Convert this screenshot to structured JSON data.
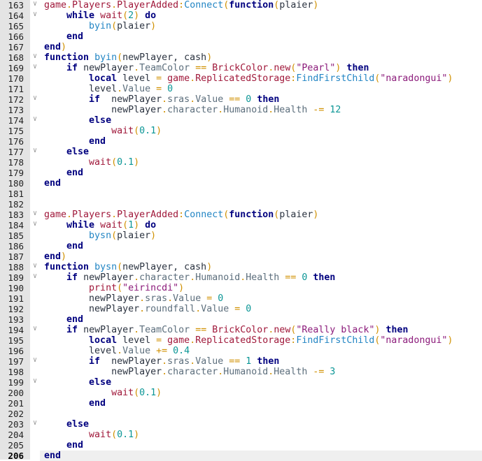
{
  "editor": {
    "current_line": 206,
    "fold_lines": [
      163,
      164,
      168,
      169,
      172,
      174,
      177,
      183,
      184,
      188,
      189,
      194,
      197,
      199,
      203
    ],
    "lines": [
      {
        "n": 163,
        "t": [
          [
            "g",
            "game"
          ],
          [
            "o",
            "."
          ],
          [
            "g",
            "Players"
          ],
          [
            "o",
            "."
          ],
          [
            "g",
            "PlayerAdded"
          ],
          [
            "o",
            ":"
          ],
          [
            "b",
            "Connect"
          ],
          [
            "o",
            "("
          ],
          [
            "k",
            "function"
          ],
          [
            "o",
            "("
          ],
          [
            "i",
            "plaier"
          ],
          [
            "o",
            ")"
          ]
        ]
      },
      {
        "n": 164,
        "t": [
          [
            "w",
            "    "
          ],
          [
            "k",
            "while"
          ],
          [
            "w",
            " "
          ],
          [
            "g",
            "wait"
          ],
          [
            "o",
            "("
          ],
          [
            "n",
            "2"
          ],
          [
            "o",
            ")"
          ],
          [
            "w",
            " "
          ],
          [
            "k",
            "do"
          ]
        ]
      },
      {
        "n": 165,
        "t": [
          [
            "w",
            "        "
          ],
          [
            "b",
            "byin"
          ],
          [
            "o",
            "("
          ],
          [
            "i",
            "plaier"
          ],
          [
            "o",
            ")"
          ]
        ]
      },
      {
        "n": 166,
        "t": [
          [
            "w",
            "    "
          ],
          [
            "k",
            "end"
          ]
        ]
      },
      {
        "n": 167,
        "t": [
          [
            "k",
            "end"
          ],
          [
            "o",
            ")"
          ]
        ]
      },
      {
        "n": 168,
        "t": [
          [
            "k",
            "function"
          ],
          [
            "w",
            " "
          ],
          [
            "b",
            "byin"
          ],
          [
            "o",
            "("
          ],
          [
            "i",
            "newPlayer, cash"
          ],
          [
            "o",
            ")"
          ]
        ]
      },
      {
        "n": 169,
        "t": [
          [
            "w",
            "    "
          ],
          [
            "k",
            "if"
          ],
          [
            "w",
            " "
          ],
          [
            "i",
            "newPlayer"
          ],
          [
            "o",
            "."
          ],
          [
            "f",
            "TeamColor"
          ],
          [
            "w",
            " "
          ],
          [
            "o",
            "=="
          ],
          [
            "w",
            " "
          ],
          [
            "g",
            "BrickColor"
          ],
          [
            "o",
            "."
          ],
          [
            "g",
            "new"
          ],
          [
            "o",
            "("
          ],
          [
            "s",
            "\"Pearl\""
          ],
          [
            "o",
            ")"
          ],
          [
            "w",
            " "
          ],
          [
            "k",
            "then"
          ]
        ]
      },
      {
        "n": 170,
        "t": [
          [
            "w",
            "        "
          ],
          [
            "k",
            "local"
          ],
          [
            "i",
            " level "
          ],
          [
            "o",
            "="
          ],
          [
            "w",
            " "
          ],
          [
            "g",
            "game"
          ],
          [
            "o",
            "."
          ],
          [
            "g",
            "ReplicatedStorage"
          ],
          [
            "o",
            ":"
          ],
          [
            "b",
            "FindFirstChild"
          ],
          [
            "o",
            "("
          ],
          [
            "s",
            "\"naradongui\""
          ],
          [
            "o",
            ")"
          ]
        ]
      },
      {
        "n": 171,
        "t": [
          [
            "w",
            "        "
          ],
          [
            "i",
            "level"
          ],
          [
            "o",
            "."
          ],
          [
            "f",
            "Value"
          ],
          [
            "w",
            " "
          ],
          [
            "o",
            "="
          ],
          [
            "w",
            " "
          ],
          [
            "n",
            "0"
          ]
        ]
      },
      {
        "n": 172,
        "t": [
          [
            "w",
            "        "
          ],
          [
            "k",
            "if"
          ],
          [
            "w",
            "  "
          ],
          [
            "i",
            "newPlayer"
          ],
          [
            "o",
            "."
          ],
          [
            "f",
            "sras"
          ],
          [
            "o",
            "."
          ],
          [
            "f",
            "Value"
          ],
          [
            "w",
            " "
          ],
          [
            "o",
            "=="
          ],
          [
            "w",
            " "
          ],
          [
            "n",
            "0"
          ],
          [
            "w",
            " "
          ],
          [
            "k",
            "then"
          ]
        ]
      },
      {
        "n": 173,
        "t": [
          [
            "w",
            "            "
          ],
          [
            "i",
            "newPlayer"
          ],
          [
            "o",
            "."
          ],
          [
            "f",
            "character"
          ],
          [
            "o",
            "."
          ],
          [
            "f",
            "Humanoid"
          ],
          [
            "o",
            "."
          ],
          [
            "f",
            "Health"
          ],
          [
            "w",
            " "
          ],
          [
            "o",
            "-="
          ],
          [
            "w",
            " "
          ],
          [
            "n",
            "12"
          ]
        ]
      },
      {
        "n": 174,
        "t": [
          [
            "w",
            "        "
          ],
          [
            "k",
            "else"
          ]
        ]
      },
      {
        "n": 175,
        "t": [
          [
            "w",
            "            "
          ],
          [
            "g",
            "wait"
          ],
          [
            "o",
            "("
          ],
          [
            "n",
            "0.1"
          ],
          [
            "o",
            ")"
          ]
        ]
      },
      {
        "n": 176,
        "t": [
          [
            "w",
            "        "
          ],
          [
            "k",
            "end"
          ]
        ]
      },
      {
        "n": 177,
        "t": [
          [
            "w",
            "    "
          ],
          [
            "k",
            "else"
          ]
        ]
      },
      {
        "n": 178,
        "t": [
          [
            "w",
            "        "
          ],
          [
            "g",
            "wait"
          ],
          [
            "o",
            "("
          ],
          [
            "n",
            "0.1"
          ],
          [
            "o",
            ")"
          ]
        ]
      },
      {
        "n": 179,
        "t": [
          [
            "w",
            "    "
          ],
          [
            "k",
            "end"
          ]
        ]
      },
      {
        "n": 180,
        "t": [
          [
            "k",
            "end"
          ]
        ]
      },
      {
        "n": 181,
        "t": []
      },
      {
        "n": 182,
        "t": []
      },
      {
        "n": 183,
        "t": [
          [
            "g",
            "game"
          ],
          [
            "o",
            "."
          ],
          [
            "g",
            "Players"
          ],
          [
            "o",
            "."
          ],
          [
            "g",
            "PlayerAdded"
          ],
          [
            "o",
            ":"
          ],
          [
            "b",
            "Connect"
          ],
          [
            "o",
            "("
          ],
          [
            "k",
            "function"
          ],
          [
            "o",
            "("
          ],
          [
            "i",
            "plaier"
          ],
          [
            "o",
            ")"
          ]
        ]
      },
      {
        "n": 184,
        "t": [
          [
            "w",
            "    "
          ],
          [
            "k",
            "while"
          ],
          [
            "w",
            " "
          ],
          [
            "g",
            "wait"
          ],
          [
            "o",
            "("
          ],
          [
            "n",
            "1"
          ],
          [
            "o",
            ")"
          ],
          [
            "w",
            " "
          ],
          [
            "k",
            "do"
          ]
        ]
      },
      {
        "n": 185,
        "t": [
          [
            "w",
            "        "
          ],
          [
            "b",
            "bysn"
          ],
          [
            "o",
            "("
          ],
          [
            "i",
            "plaier"
          ],
          [
            "o",
            ")"
          ]
        ]
      },
      {
        "n": 186,
        "t": [
          [
            "w",
            "    "
          ],
          [
            "k",
            "end"
          ]
        ]
      },
      {
        "n": 187,
        "t": [
          [
            "k",
            "end"
          ],
          [
            "o",
            ")"
          ]
        ]
      },
      {
        "n": 188,
        "t": [
          [
            "k",
            "function"
          ],
          [
            "w",
            " "
          ],
          [
            "b",
            "bysn"
          ],
          [
            "o",
            "("
          ],
          [
            "i",
            "newPlayer, cash"
          ],
          [
            "o",
            ")"
          ]
        ]
      },
      {
        "n": 189,
        "t": [
          [
            "w",
            "    "
          ],
          [
            "k",
            "if"
          ],
          [
            "w",
            " "
          ],
          [
            "i",
            "newPlayer"
          ],
          [
            "o",
            "."
          ],
          [
            "f",
            "character"
          ],
          [
            "o",
            "."
          ],
          [
            "f",
            "Humanoid"
          ],
          [
            "o",
            "."
          ],
          [
            "f",
            "Health"
          ],
          [
            "w",
            " "
          ],
          [
            "o",
            "=="
          ],
          [
            "w",
            " "
          ],
          [
            "n",
            "0"
          ],
          [
            "w",
            " "
          ],
          [
            "k",
            "then"
          ]
        ]
      },
      {
        "n": 190,
        "t": [
          [
            "w",
            "        "
          ],
          [
            "g",
            "print"
          ],
          [
            "o",
            "("
          ],
          [
            "s",
            "\"eirincdi\""
          ],
          [
            "o",
            ")"
          ]
        ]
      },
      {
        "n": 191,
        "t": [
          [
            "w",
            "        "
          ],
          [
            "i",
            "newPlayer"
          ],
          [
            "o",
            "."
          ],
          [
            "f",
            "sras"
          ],
          [
            "o",
            "."
          ],
          [
            "f",
            "Value"
          ],
          [
            "w",
            " "
          ],
          [
            "o",
            "="
          ],
          [
            "w",
            " "
          ],
          [
            "n",
            "0"
          ]
        ]
      },
      {
        "n": 192,
        "t": [
          [
            "w",
            "        "
          ],
          [
            "i",
            "newPlayer"
          ],
          [
            "o",
            "."
          ],
          [
            "f",
            "roundfall"
          ],
          [
            "o",
            "."
          ],
          [
            "f",
            "Value"
          ],
          [
            "w",
            " "
          ],
          [
            "o",
            "="
          ],
          [
            "w",
            " "
          ],
          [
            "n",
            "0"
          ]
        ]
      },
      {
        "n": 193,
        "t": [
          [
            "w",
            "    "
          ],
          [
            "k",
            "end"
          ]
        ]
      },
      {
        "n": 194,
        "t": [
          [
            "w",
            "    "
          ],
          [
            "k",
            "if"
          ],
          [
            "w",
            " "
          ],
          [
            "i",
            "newPlayer"
          ],
          [
            "o",
            "."
          ],
          [
            "f",
            "TeamColor"
          ],
          [
            "w",
            " "
          ],
          [
            "o",
            "=="
          ],
          [
            "w",
            " "
          ],
          [
            "g",
            "BrickColor"
          ],
          [
            "o",
            "."
          ],
          [
            "g",
            "new"
          ],
          [
            "o",
            "("
          ],
          [
            "s",
            "\"Really black\""
          ],
          [
            "o",
            ")"
          ],
          [
            "w",
            " "
          ],
          [
            "k",
            "then"
          ]
        ]
      },
      {
        "n": 195,
        "t": [
          [
            "w",
            "        "
          ],
          [
            "k",
            "local"
          ],
          [
            "i",
            " level "
          ],
          [
            "o",
            "="
          ],
          [
            "w",
            " "
          ],
          [
            "g",
            "game"
          ],
          [
            "o",
            "."
          ],
          [
            "g",
            "ReplicatedStorage"
          ],
          [
            "o",
            ":"
          ],
          [
            "b",
            "FindFirstChild"
          ],
          [
            "o",
            "("
          ],
          [
            "s",
            "\"naradongui\""
          ],
          [
            "o",
            ")"
          ]
        ]
      },
      {
        "n": 196,
        "t": [
          [
            "w",
            "        "
          ],
          [
            "i",
            "level"
          ],
          [
            "o",
            "."
          ],
          [
            "f",
            "Value"
          ],
          [
            "w",
            " "
          ],
          [
            "o",
            "+="
          ],
          [
            "w",
            " "
          ],
          [
            "n",
            "0.4"
          ]
        ]
      },
      {
        "n": 197,
        "t": [
          [
            "w",
            "        "
          ],
          [
            "k",
            "if"
          ],
          [
            "w",
            "  "
          ],
          [
            "i",
            "newPlayer"
          ],
          [
            "o",
            "."
          ],
          [
            "f",
            "sras"
          ],
          [
            "o",
            "."
          ],
          [
            "f",
            "Value"
          ],
          [
            "w",
            " "
          ],
          [
            "o",
            "=="
          ],
          [
            "w",
            " "
          ],
          [
            "n",
            "1"
          ],
          [
            "w",
            " "
          ],
          [
            "k",
            "then"
          ]
        ]
      },
      {
        "n": 198,
        "t": [
          [
            "w",
            "            "
          ],
          [
            "i",
            "newPlayer"
          ],
          [
            "o",
            "."
          ],
          [
            "f",
            "character"
          ],
          [
            "o",
            "."
          ],
          [
            "f",
            "Humanoid"
          ],
          [
            "o",
            "."
          ],
          [
            "f",
            "Health"
          ],
          [
            "w",
            " "
          ],
          [
            "o",
            "-="
          ],
          [
            "w",
            " "
          ],
          [
            "n",
            "3"
          ]
        ]
      },
      {
        "n": 199,
        "t": [
          [
            "w",
            "        "
          ],
          [
            "k",
            "else"
          ]
        ]
      },
      {
        "n": 200,
        "t": [
          [
            "w",
            "            "
          ],
          [
            "g",
            "wait"
          ],
          [
            "o",
            "("
          ],
          [
            "n",
            "0.1"
          ],
          [
            "o",
            ")"
          ]
        ]
      },
      {
        "n": 201,
        "t": [
          [
            "w",
            "        "
          ],
          [
            "k",
            "end"
          ]
        ]
      },
      {
        "n": 202,
        "t": []
      },
      {
        "n": 203,
        "t": [
          [
            "w",
            "    "
          ],
          [
            "k",
            "else"
          ]
        ]
      },
      {
        "n": 204,
        "t": [
          [
            "w",
            "        "
          ],
          [
            "g",
            "wait"
          ],
          [
            "o",
            "("
          ],
          [
            "n",
            "0.1"
          ],
          [
            "o",
            ")"
          ]
        ]
      },
      {
        "n": 205,
        "t": [
          [
            "w",
            "    "
          ],
          [
            "k",
            "end"
          ]
        ]
      },
      {
        "n": 206,
        "t": [
          [
            "k",
            "end"
          ]
        ]
      }
    ]
  }
}
